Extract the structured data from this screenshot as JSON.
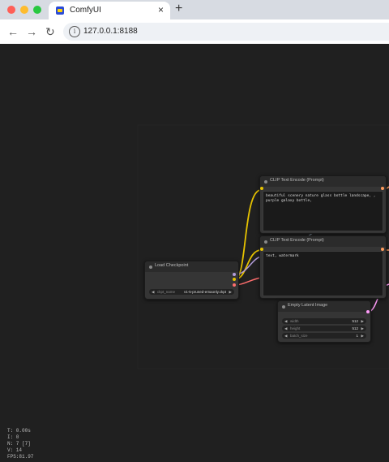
{
  "browser": {
    "tab_title": "ComfyUI",
    "tab_close": "×",
    "new_tab": "+",
    "back": "←",
    "forward": "→",
    "reload": "↻",
    "info": "i",
    "url": "127.0.0.1:8188"
  },
  "nodes": {
    "clip1": {
      "title": "CLIP Text Encode (Prompt)",
      "text": "beautiful scenery nature glass bottle landscape, , purple galaxy bottle,"
    },
    "clip2": {
      "title": "CLIP Text Encode (Prompt)",
      "text": "text, watermark"
    },
    "checkpoint": {
      "title": "Load Checkpoint",
      "widget_name": "ckpt_name",
      "widget_value": "v1-5-pruned-emaonly.ckpt"
    },
    "latent": {
      "title": "Empty Latent Image",
      "widgets": [
        {
          "name": "width",
          "value": "512"
        },
        {
          "name": "height",
          "value": "512"
        },
        {
          "name": "batch_size",
          "value": "1"
        }
      ]
    }
  },
  "stats": [
    "T: 0.00s",
    "I: 0",
    "N: 7 [7]",
    "V: 14",
    "FPS:81.97"
  ],
  "colors": {
    "clip_wire": "#e6c200",
    "model_wire": "#b39ddb",
    "vae_wire": "#ff6e6e",
    "latent_wire": "#ff9cf9"
  }
}
